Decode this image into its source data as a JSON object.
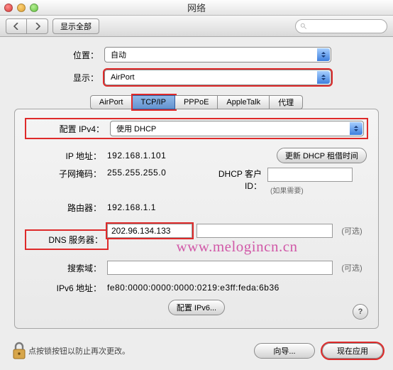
{
  "window": {
    "title": "网络"
  },
  "toolbar": {
    "show_all": "显示全部",
    "search_placeholder": ""
  },
  "top": {
    "location_label": "位置：",
    "location_value": "自动",
    "show_label": "显示：",
    "show_value": "AirPort"
  },
  "tabs": {
    "airport": "AirPort",
    "tcpip": "TCP/IP",
    "pppoe": "PPPoE",
    "appletalk": "AppleTalk",
    "proxy": "代理"
  },
  "ipv4": {
    "config_label": "配置 IPv4：",
    "config_value": "使用 DHCP",
    "ip_label": "IP 地址：",
    "ip_value": "192.168.1.101",
    "renew_btn": "更新 DHCP 租借时间",
    "mask_label": "子网掩码：",
    "mask_value": "255.255.255.0",
    "client_label": "DHCP 客户 ID：",
    "client_value": "",
    "client_hint": "(如果需要)",
    "router_label": "路由器：",
    "router_value": "192.168.1.1"
  },
  "dns": {
    "label": "DNS 服务器：",
    "value": "202.96.134.133",
    "extra_value": "",
    "optional": "(可选)"
  },
  "search": {
    "label": "搜索域：",
    "value": "",
    "optional": "(可选)"
  },
  "ipv6": {
    "label": "IPv6 地址：",
    "value": "fe80:0000:0000:0000:0219:e3ff:feda:6b36",
    "config_btn": "配置 IPv6..."
  },
  "footer": {
    "lock_text": "点按锁按钮以防止再次更改。",
    "assist_btn": "向导...",
    "apply_btn": "现在应用"
  },
  "help_label": "?",
  "watermark": "www.melogincn.cn"
}
